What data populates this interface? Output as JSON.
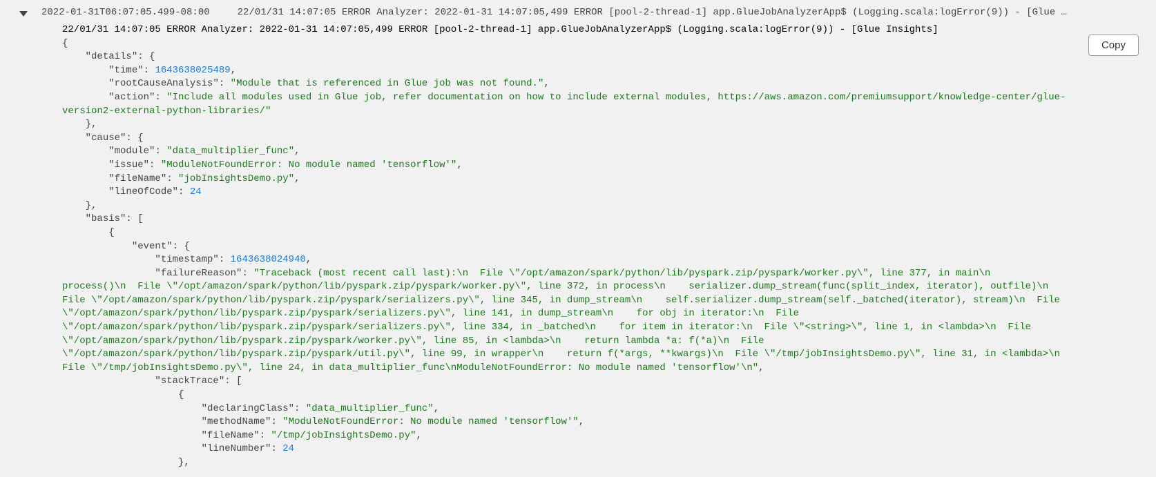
{
  "copy_label": "Copy",
  "summary": {
    "timestamp_iso": "2022-01-31T06:07:05.499-08:00",
    "line": "22/01/31 14:07:05 ERROR Analyzer: 2022-01-31 14:07:05,499 ERROR [pool-2-thread-1] app.GlueJobAnalyzerApp$ (Logging.scala:logError(9)) - [Glue …"
  },
  "detail": {
    "header": "22/01/31 14:07:05 ERROR Analyzer: 2022-01-31 14:07:05,499 ERROR [pool-2-thread-1] app.GlueJobAnalyzerApp$ (Logging.scala:logError(9)) - [Glue Insights]",
    "details_time": 1643638025489,
    "details_rootCauseAnalysis": "Module that is referenced in Glue job was not found.",
    "details_action": "Include all modules used in Glue job, refer documentation on how to include external modules, https://aws.amazon.com/premiumsupport/knowledge-center/glue-version2-external-python-libraries/",
    "cause_module": "data_multiplier_func",
    "cause_issue": "ModuleNotFoundError: No module named 'tensorflow'",
    "cause_fileName": "jobInsightsDemo.py",
    "cause_lineOfCode": 24,
    "basis_event_timestamp": 1643638024940,
    "basis_event_failureReason": "Traceback (most recent call last):\\n  File \\\"/opt/amazon/spark/python/lib/pyspark.zip/pyspark/worker.py\\\", line 377, in main\\n    process()\\n  File \\\"/opt/amazon/spark/python/lib/pyspark.zip/pyspark/worker.py\\\", line 372, in process\\n    serializer.dump_stream(func(split_index, iterator), outfile)\\n  File \\\"/opt/amazon/spark/python/lib/pyspark.zip/pyspark/serializers.py\\\", line 345, in dump_stream\\n    self.serializer.dump_stream(self._batched(iterator), stream)\\n  File \\\"/opt/amazon/spark/python/lib/pyspark.zip/pyspark/serializers.py\\\", line 141, in dump_stream\\n    for obj in iterator:\\n  File \\\"/opt/amazon/spark/python/lib/pyspark.zip/pyspark/serializers.py\\\", line 334, in _batched\\n    for item in iterator:\\n  File \\\"<string>\\\", line 1, in <lambda>\\n  File \\\"/opt/amazon/spark/python/lib/pyspark.zip/pyspark/worker.py\\\", line 85, in <lambda>\\n    return lambda *a: f(*a)\\n  File \\\"/opt/amazon/spark/python/lib/pyspark.zip/pyspark/util.py\\\", line 99, in wrapper\\n    return f(*args, **kwargs)\\n  File \\\"/tmp/jobInsightsDemo.py\\\", line 31, in <lambda>\\n  File \\\"/tmp/jobInsightsDemo.py\\\", line 24, in data_multiplier_func\\nModuleNotFoundError: No module named 'tensorflow'\\n",
    "stackTrace_declaringClass": "data_multiplier_func",
    "stackTrace_methodName": "ModuleNotFoundError: No module named 'tensorflow'",
    "stackTrace_fileName": "/tmp/jobInsightsDemo.py",
    "stackTrace_lineNumber": 24
  }
}
